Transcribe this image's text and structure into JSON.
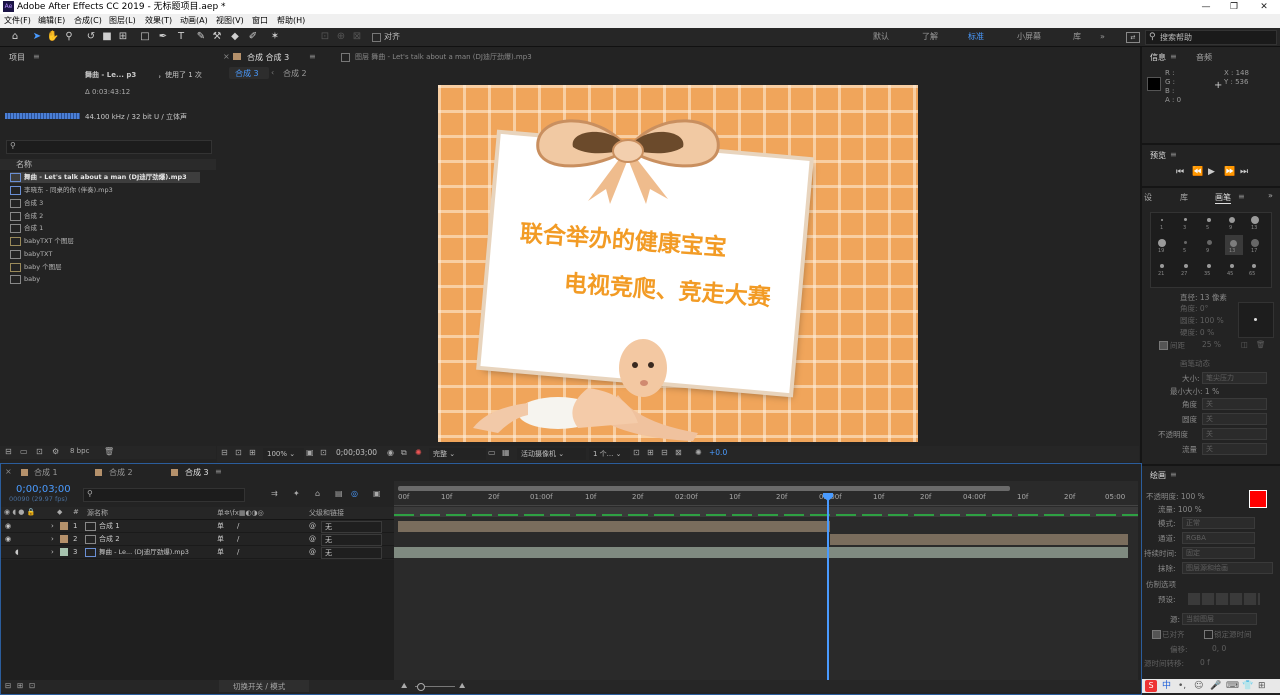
{
  "window": {
    "title": "Adobe After Effects CC 2019 - 无标题项目.aep *",
    "app_icon": "Ae"
  },
  "menu": [
    "文件(F)",
    "编辑(E)",
    "合成(C)",
    "图层(L)",
    "效果(T)",
    "动画(A)",
    "视图(V)",
    "窗口",
    "帮助(H)"
  ],
  "toolbar": {
    "align_label": "对齐",
    "workspaces": [
      "默认",
      "了解",
      "标准",
      "小屏幕",
      "库"
    ],
    "search_placeholder": "搜索帮助",
    "more": "»"
  },
  "project": {
    "title": "项目",
    "selected_name": "舞曲 - Le... p3",
    "used": "，使用了 1 次",
    "duration": "Δ 0:03:43:12",
    "audio_info": "44.100 kHz / 32 bit U / 立体声",
    "col_name": "名称",
    "items": [
      {
        "name": "舞曲 - Let's talk about a man (DJ迪厅劲爆).mp3",
        "type": "audio",
        "selected": true
      },
      {
        "name": "李晓东 - 同桌的你 (伴奏).mp3",
        "type": "audio"
      },
      {
        "name": "合成 3",
        "type": "comp"
      },
      {
        "name": "合成 2",
        "type": "comp"
      },
      {
        "name": "合成 1",
        "type": "comp"
      },
      {
        "name": "babyTXT 个图层",
        "type": "folder"
      },
      {
        "name": "babyTXT",
        "type": "comp"
      },
      {
        "name": "baby 个图层",
        "type": "folder"
      },
      {
        "name": "baby",
        "type": "comp"
      }
    ],
    "bpc": "8 bpc"
  },
  "viewer": {
    "tab_comp": "合成 合成 3",
    "tab_layer": "图层 舞曲 - Let's talk about a man (DJ迪厅劲爆).mp3",
    "sub_tabs": [
      "合成 3",
      "合成 2"
    ],
    "card_line1": "联合举办的健康宝宝",
    "card_line2": "电视竞爬、竞走大赛",
    "zoom": "100%",
    "timecode": "0;00;03;00",
    "resolution": "完整",
    "camera": "活动摄像机",
    "views": "1 个...",
    "exposure": "+0.0",
    "bg_color": "#f0a55b"
  },
  "info": {
    "title": "信息",
    "audio_tab": "音频",
    "r": "R :",
    "g": "G :",
    "b": "B :",
    "a": "A : 0",
    "x": "X : 148",
    "y": "Y : 536"
  },
  "preview": {
    "title": "预览"
  },
  "brushes": {
    "tabs": [
      "设",
      "库",
      "画笔"
    ],
    "sizes": [
      "1",
      "3",
      "5",
      "9",
      "13",
      "19",
      "5",
      "9",
      "13",
      "17",
      "21",
      "27",
      "35",
      "45",
      "65"
    ],
    "diameter": "直径: 13 像素",
    "angle": "角度: 0°",
    "roundness": "圆度: 100 %",
    "hardness": "硬度: 0 %",
    "spacing_label": "间距",
    "spacing": "25 %",
    "dynamics": "画笔动态",
    "size_label": "大小:",
    "size_val": "笔尖压力",
    "min_size": "最小大小: 1 %",
    "angle2": "角度",
    "roundness2": "圆度",
    "opacity2": "不透明度",
    "flow2": "流量",
    "off": "关"
  },
  "paint": {
    "title": "绘画",
    "opacity": "不透明度: 100 %",
    "flow": "流量: 100 %",
    "mode_label": "模式:",
    "mode": "正常",
    "channel_label": "通道:",
    "channel": "RGBA",
    "duration_label": "持续时间:",
    "duration": "固定",
    "erase_label": "抹除:",
    "erase": "图层源和绘画",
    "clone": "仿制选项",
    "preset": "预设:",
    "source_label": "源:",
    "source": "当前图层",
    "aligned": "已对齐",
    "lock_time": "锁定源时间",
    "offset": "偏移:",
    "offset_val": "0, 0",
    "src_time": "源时间转移:",
    "src_time_val": "0 f",
    "fg_color": "#ff0000",
    "bg_color": "#ffffff"
  },
  "timeline": {
    "tabs": [
      "合成 1",
      "合成 2",
      "合成 3"
    ],
    "timecode": "0;00;03;00",
    "frames": "00090 (29.97 fps)",
    "col_source": "源名称",
    "col_parent": "父级和链接",
    "layers": [
      {
        "num": "1",
        "name": "合成 1",
        "type": "comp",
        "parent": "无",
        "color": "#b5916b"
      },
      {
        "num": "2",
        "name": "合成 2",
        "type": "comp",
        "parent": "无",
        "color": "#b5916b"
      },
      {
        "num": "3",
        "name": "舞曲 - Le... (DJ迪厅劲爆).mp3",
        "type": "audio",
        "parent": "无",
        "color": "#a8c4b0"
      }
    ],
    "ruler": [
      "00f",
      "10f",
      "20f",
      "01:00f",
      "10f",
      "20f",
      "02:00f",
      "10f",
      "20f",
      "03:00f",
      "10f",
      "20f",
      "04:00f",
      "10f",
      "20f",
      "05:00"
    ],
    "footer": "切换开关 / 模式"
  },
  "taskbar": {
    "ime": "中"
  }
}
